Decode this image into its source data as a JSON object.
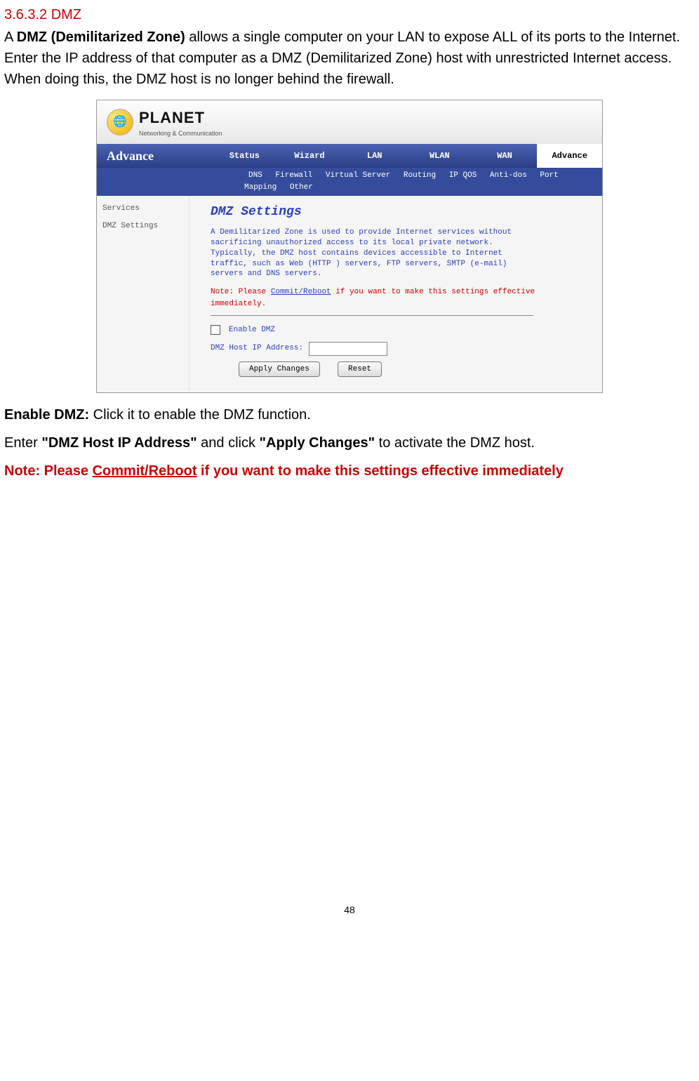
{
  "section": {
    "number": "3.6.3.2",
    "title": "DMZ"
  },
  "intro": {
    "prefix": "A ",
    "bold1": "DMZ (Demilitarized Zone)",
    "rest": " allows a single computer on your LAN to expose ALL of its ports to the Internet. Enter the IP address of that computer as a DMZ (Demilitarized Zone) host with unrestricted Internet access. When doing this, the DMZ host is no longer behind the firewall."
  },
  "screenshot": {
    "brand": "PLANET",
    "brand_sub": "Networking & Communication",
    "top_nav_title": "Advance",
    "nav": [
      "Status",
      "Wizard",
      "LAN",
      "WLAN",
      "WAN",
      "Advance"
    ],
    "active_nav": "Advance",
    "subnav": [
      "DNS",
      "Firewall",
      "Virtual Server",
      "Routing",
      "IP QOS",
      "Anti-dos",
      "Port Mapping",
      "Other"
    ],
    "side": [
      "Services",
      "DMZ Settings"
    ],
    "panel_title": "DMZ Settings",
    "panel_desc": "A Demilitarized Zone is used to provide Internet services without sacrificing unauthorized access to its local private network. Typically, the DMZ host contains devices accessible to Internet traffic, such as Web (HTTP ) servers, FTP servers, SMTP (e-mail) servers and DNS servers.",
    "panel_note_prefix": "Note: Please ",
    "panel_note_link": "Commit/Reboot",
    "panel_note_suffix": " if you want to make this settings effective immediately.",
    "enable_label": "Enable DMZ",
    "host_label": "DMZ Host IP Address:",
    "btn_apply": "Apply Changes",
    "btn_reset": "Reset"
  },
  "post": {
    "enable_bold": "Enable DMZ:",
    "enable_rest": " Click it to enable the DMZ function.",
    "line2_a": "Enter ",
    "line2_b": "\"DMZ Host IP Address\"",
    "line2_c": " and click ",
    "line2_d": "\"Apply Changes\"",
    "line2_e": " to activate the DMZ host."
  },
  "note": {
    "a": "Note: Please ",
    "b": "Commit/Reboot",
    "c": " if you want to make this settings effective immediately"
  },
  "page_number": "48"
}
